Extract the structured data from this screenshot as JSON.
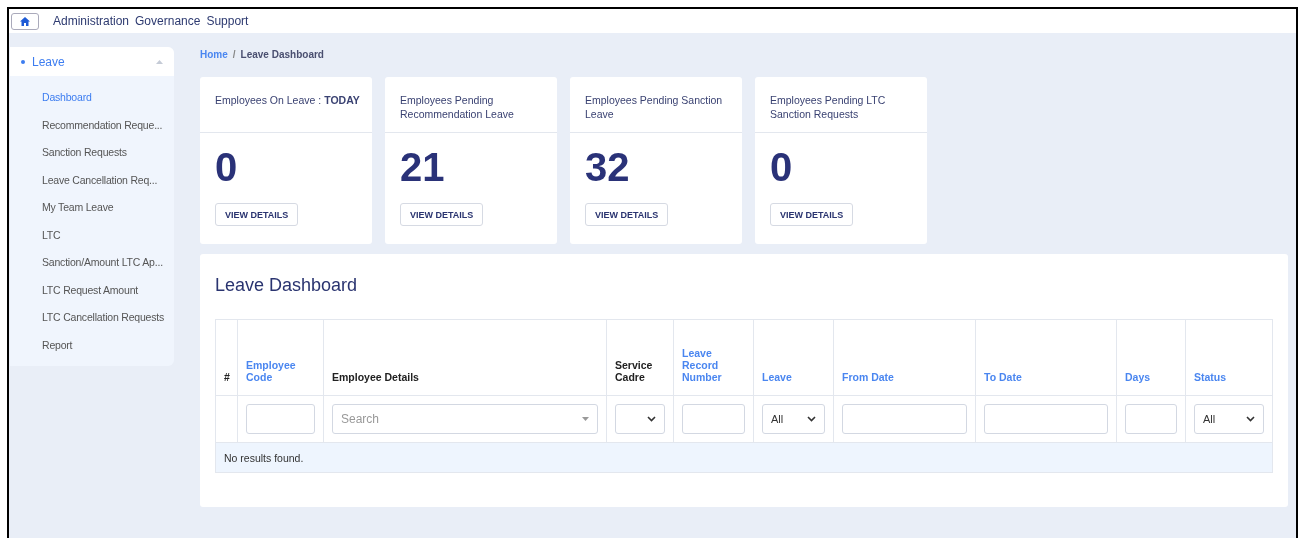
{
  "top_nav": {
    "items": [
      "Administration",
      "Governance",
      "Support"
    ]
  },
  "sidebar": {
    "group": {
      "label": "Leave",
      "expanded": true
    },
    "items": [
      {
        "label": "Dashboard",
        "selected": true
      },
      {
        "label": "Recommendation Reque...",
        "selected": false
      },
      {
        "label": "Sanction Requests",
        "selected": false
      },
      {
        "label": "Leave Cancellation Req...",
        "selected": false
      },
      {
        "label": "My Team Leave",
        "selected": false
      },
      {
        "label": "LTC",
        "selected": false
      },
      {
        "label": "Sanction/Amount LTC Ap...",
        "selected": false
      },
      {
        "label": "LTC Request Amount",
        "selected": false
      },
      {
        "label": "LTC Cancellation Requests",
        "selected": false
      },
      {
        "label": "Report",
        "selected": false
      }
    ]
  },
  "breadcrumb": {
    "separator": "/",
    "items": [
      "Home",
      "Leave Dashboard"
    ]
  },
  "cards": [
    {
      "title": "Employees On Leave : **TODAY**",
      "value": "0",
      "button": "VIEW DETAILS"
    },
    {
      "title": "Employees Pending Recommendation Leave",
      "value": "21",
      "button": "VIEW DETAILS"
    },
    {
      "title": "Employees Pending Sanction Leave",
      "value": "32",
      "button": "VIEW DETAILS"
    },
    {
      "title": "Employees Pending LTC Sanction Requests",
      "value": "0",
      "button": "VIEW DETAILS"
    }
  ],
  "panel": {
    "title": "Leave Dashboard"
  },
  "table": {
    "columns": [
      {
        "label": "#",
        "kind": "plain",
        "filter": {
          "kind": "none"
        }
      },
      {
        "label": "Employee Code",
        "kind": "sortable",
        "filter": {
          "kind": "text"
        }
      },
      {
        "label": "Employee Details",
        "kind": "plain",
        "filter": {
          "kind": "search-select",
          "placeholder": "Search"
        }
      },
      {
        "label": "Service Cadre",
        "kind": "plain",
        "filter": {
          "kind": "select"
        }
      },
      {
        "label": "Leave Record Number",
        "kind": "sortable",
        "filter": {
          "kind": "text"
        }
      },
      {
        "label": "Leave",
        "kind": "sortable",
        "filter": {
          "kind": "select",
          "value": "All"
        }
      },
      {
        "label": "From Date",
        "kind": "sortable",
        "filter": {
          "kind": "text"
        }
      },
      {
        "label": "To Date",
        "kind": "sortable",
        "filter": {
          "kind": "text"
        }
      },
      {
        "label": "Days",
        "kind": "sortable",
        "filter": {
          "kind": "text"
        }
      },
      {
        "label": "Status",
        "kind": "sortable",
        "filter": {
          "kind": "select",
          "value": "All"
        }
      }
    ],
    "empty_message": "No results found."
  }
}
